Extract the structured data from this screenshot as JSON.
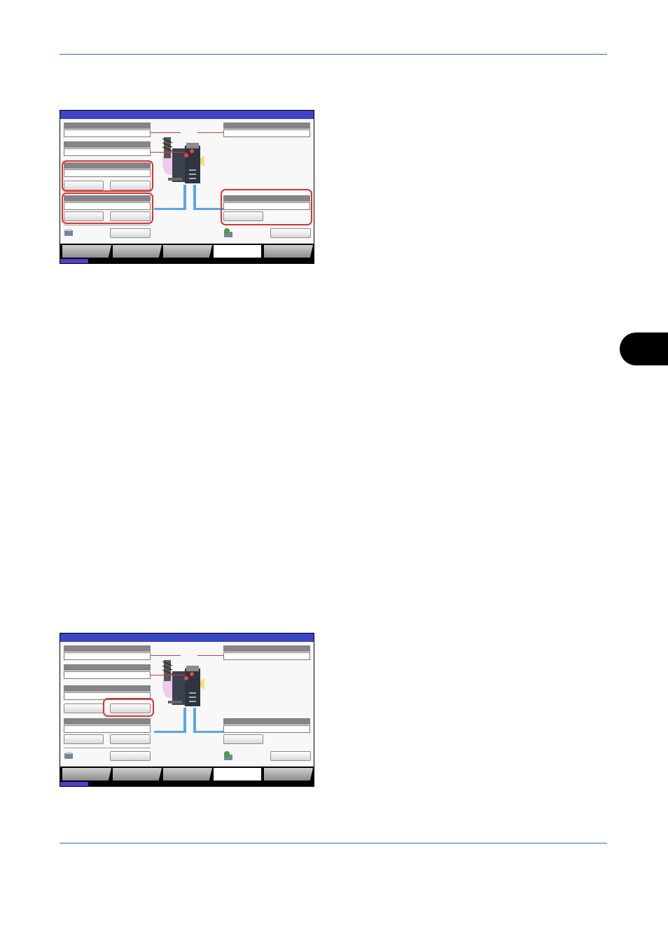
{
  "colors": {
    "rule": "#2d6fb8",
    "chapter_tab": "#000000",
    "titlebar": "#3d44c8",
    "status_indicator": "#5a3ad0",
    "highlight": "#e03030",
    "network_line": "#5aa5e6"
  },
  "icons": [
    "printer-device-icon",
    "scanner-device-icon",
    "network-globe-icon"
  ],
  "screenshots": [
    {
      "highlights": [
        "left-panel-3-group",
        "left-panel-4-group",
        "right-panel-2-group"
      ]
    },
    {
      "highlights": [
        "left-panel-3-right-button"
      ]
    }
  ]
}
